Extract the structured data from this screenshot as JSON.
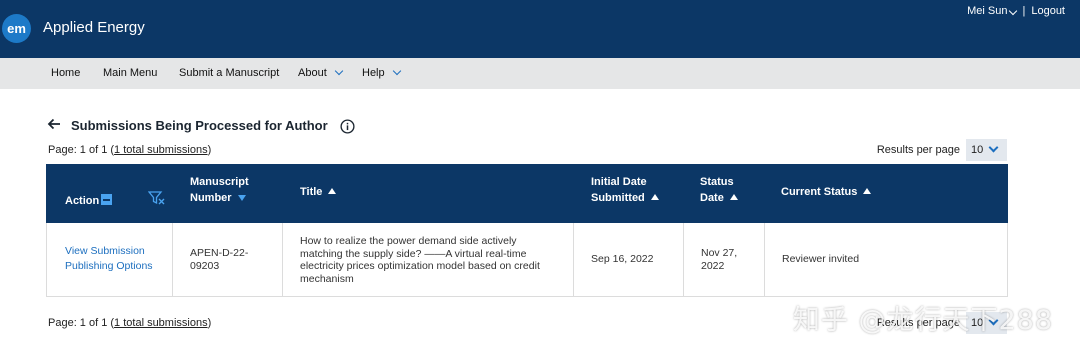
{
  "header": {
    "logo_text": "em",
    "app_title": "Applied Energy",
    "user_name": "Mei Sun",
    "separator": "|",
    "logout_label": "Logout",
    "bg_color": "#0c3766"
  },
  "nav": {
    "items": [
      {
        "label": "Home"
      },
      {
        "label": "Main Menu"
      },
      {
        "label": "Submit a Manuscript"
      },
      {
        "label": "About"
      },
      {
        "label": "Help"
      }
    ]
  },
  "page": {
    "title": "Submissions Being Processed for Author"
  },
  "pagination": {
    "top": {
      "prefix": "Page: 1 of 1 (",
      "link": "1 total submissions",
      "suffix": ")"
    },
    "bottom": {
      "prefix": "Page: 1 of 1 (",
      "link": "1 total submissions",
      "suffix": ")"
    }
  },
  "results_per_page": {
    "label": "Results per page",
    "value": "10"
  },
  "table": {
    "headers": {
      "action": "Action",
      "manuscript_number_1": "Manuscript",
      "manuscript_number_2": "Number",
      "title": "Title",
      "initial_date_1": "Initial Date",
      "initial_date_2": "Submitted",
      "status_date_1": "Status",
      "status_date_2": "Date",
      "current_status": "Current Status"
    },
    "rows": [
      {
        "actions": [
          "View Submission",
          "Publishing Options"
        ],
        "manuscript_number_lines": [
          "APEN-D-22-",
          "09203"
        ],
        "title_lines": [
          "How to realize the power demand side actively",
          "matching the supply side? ——A virtual real-time",
          "electricity prices optimization model based on credit",
          "mechanism"
        ],
        "initial_date": "Sep 16, 2022",
        "status_date_lines": [
          "Nov 27,",
          "2022"
        ],
        "current_status": "Reviewer invited"
      }
    ]
  },
  "watermark": "知乎 @龙行天下288"
}
